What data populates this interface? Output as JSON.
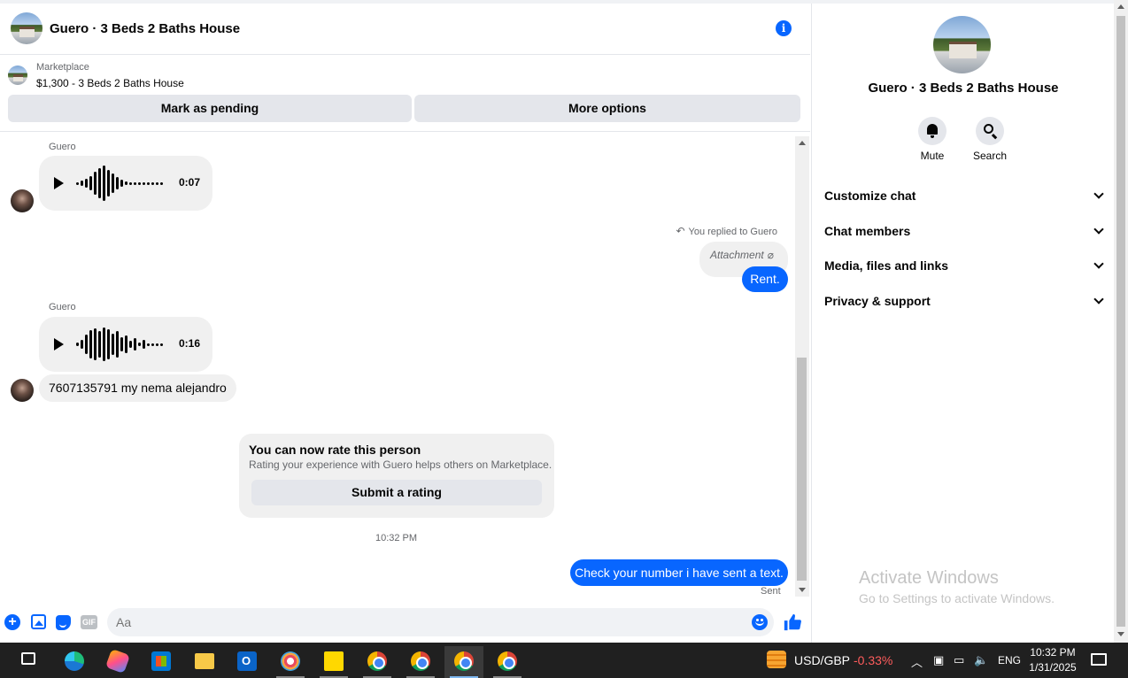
{
  "chat": {
    "title": "Guero · 3 Beds 2 Baths House",
    "marketplace_label": "Marketplace",
    "listing": "$1,300 - 3 Beds 2 Baths House",
    "mark_pending": "Mark as pending",
    "more_options": "More options"
  },
  "messages": {
    "sender_1": "Guero",
    "audio_1_duration": "0:07",
    "reply_note": "You replied to Guero",
    "attachment_label": "Attachment",
    "reply_text": "Rent.",
    "sender_2": "Guero",
    "audio_2_duration": "0:16",
    "text_in": "7607135791 my nema alejandro",
    "rate_title": "You can now rate this person",
    "rate_sub": "Rating your experience with Guero helps others on Marketplace.",
    "rate_button": "Submit a rating",
    "timestamp": "10:32 PM",
    "out_text": "Check your number i have sent a text.",
    "sent_status": "Sent"
  },
  "composer": {
    "placeholder": "Aa",
    "gif_label": "GIF"
  },
  "panel": {
    "title": "Guero · 3 Beds 2 Baths House",
    "mute_label": "Mute",
    "search_label": "Search",
    "sections": [
      "Customize chat",
      "Chat members",
      "Media, files and links",
      "Privacy & support"
    ],
    "watermark_title": "Activate Windows",
    "watermark_sub": "Go to Settings to activate Windows."
  },
  "taskbar": {
    "apps": [
      "task-view",
      "edge",
      "copilot",
      "store",
      "file-explorer",
      "outlook",
      "paint",
      "sticky-notes",
      "chrome-1",
      "chrome-2",
      "chrome-3",
      "chrome-4"
    ],
    "fx_pair": "USD/GBP",
    "fx_change": "-0.33%",
    "language": "ENG",
    "time": "10:32 PM",
    "date": "1/31/2025"
  },
  "colors": {
    "accent": "#0866ff",
    "bubble_gray": "#f0f0f0",
    "fx_negative": "#ff5c5c"
  }
}
